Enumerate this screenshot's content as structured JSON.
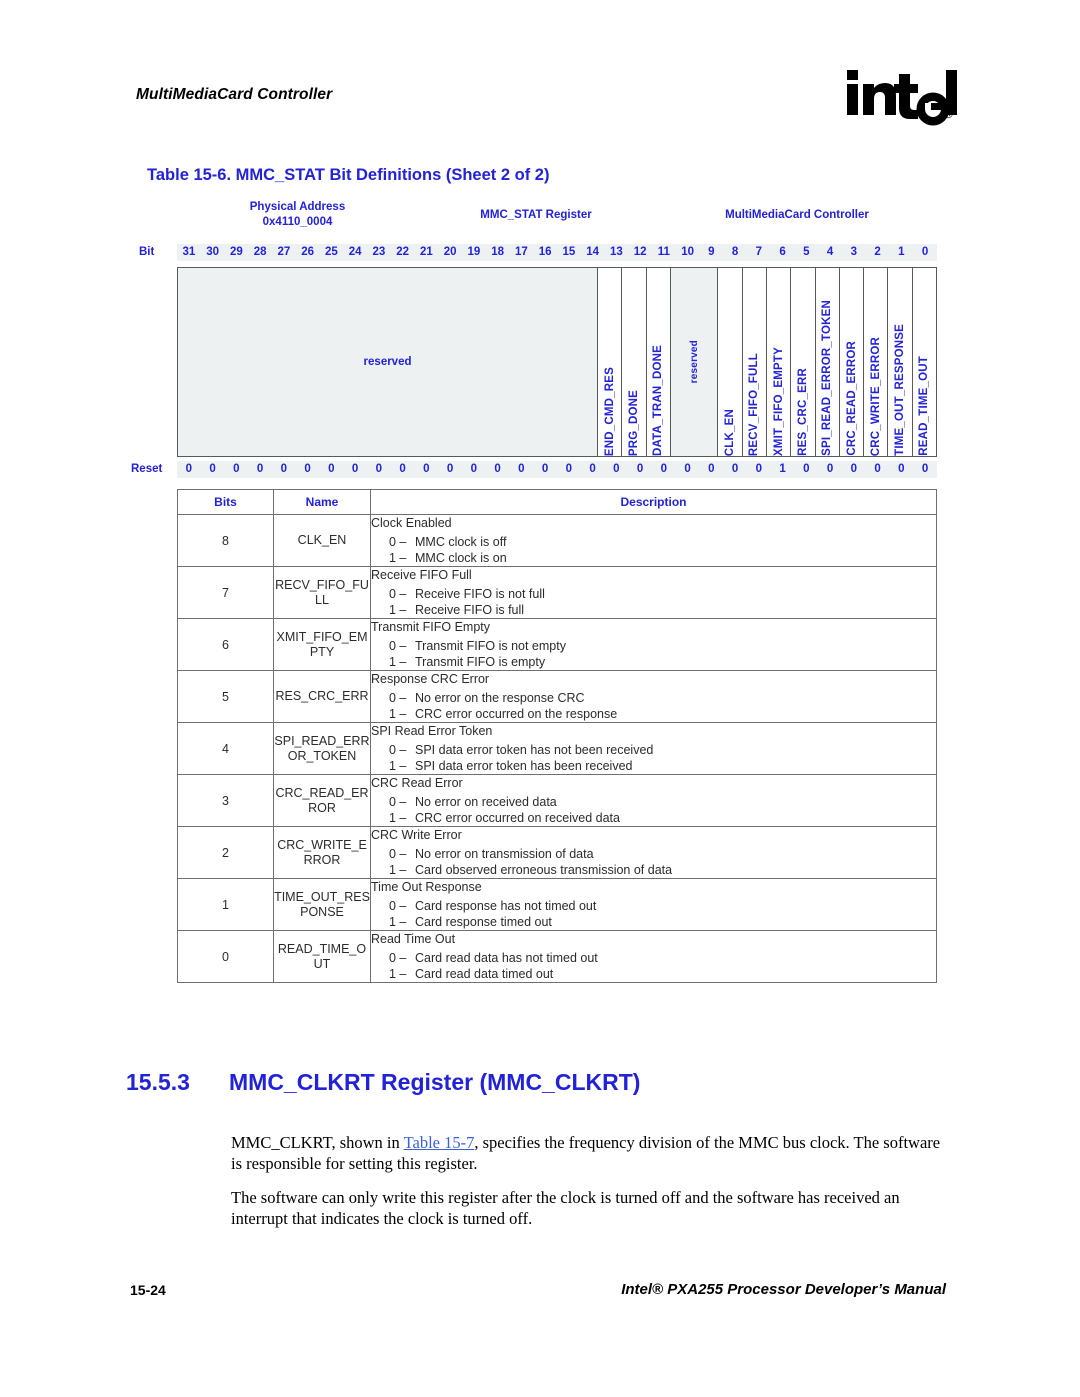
{
  "header": {
    "running_title": "MultiMediaCard Controller",
    "logo_text": "intel",
    "logo_mark": "registered-trademark"
  },
  "table_caption": "Table 15-6. MMC_STAT Bit Definitions (Sheet 2 of 2)",
  "register_diagram": {
    "physical_address_label": "Physical Address",
    "physical_address_value": "0x4110_0004",
    "register_name": "MMC_STAT Register",
    "unit_name": "MultiMediaCard Controller",
    "bit_row_label": "Bit",
    "reset_row_label": "Reset",
    "bit_numbers": [
      "31",
      "30",
      "29",
      "28",
      "27",
      "26",
      "25",
      "24",
      "23",
      "22",
      "21",
      "20",
      "19",
      "18",
      "17",
      "16",
      "15",
      "14",
      "13",
      "12",
      "11",
      "10",
      "9",
      "8",
      "7",
      "6",
      "5",
      "4",
      "3",
      "2",
      "1",
      "0"
    ],
    "reset_values": [
      "0",
      "0",
      "0",
      "0",
      "0",
      "0",
      "0",
      "0",
      "0",
      "0",
      "0",
      "0",
      "0",
      "0",
      "0",
      "0",
      "0",
      "0",
      "0",
      "0",
      "0",
      "0",
      "0",
      "0",
      "0",
      "1",
      "0",
      "0",
      "0",
      "0",
      "0",
      "0"
    ],
    "fields": [
      {
        "label": "reserved",
        "span": 18,
        "style": "grey",
        "orientation": "horizontal"
      },
      {
        "label": "END_CMD_RES",
        "span": 1,
        "style": "white",
        "orientation": "vertical"
      },
      {
        "label": "PRG_DONE",
        "span": 1,
        "style": "white",
        "orientation": "vertical"
      },
      {
        "label": "DATA_TRAN_DONE",
        "span": 1,
        "style": "white",
        "orientation": "vertical"
      },
      {
        "label": "reserved",
        "span": 2,
        "style": "grey",
        "orientation": "vertical"
      },
      {
        "label": "CLK_EN",
        "span": 1,
        "style": "white",
        "orientation": "vertical"
      },
      {
        "label": "RECV_FIFO_FULL",
        "span": 1,
        "style": "white",
        "orientation": "vertical"
      },
      {
        "label": "XMIT_FIFO_EMPTY",
        "span": 1,
        "style": "white",
        "orientation": "vertical"
      },
      {
        "label": "RES_CRC_ERR",
        "span": 1,
        "style": "white",
        "orientation": "vertical"
      },
      {
        "label": "SPI_READ_ERROR_TOKEN",
        "span": 1,
        "style": "white",
        "orientation": "vertical"
      },
      {
        "label": "CRC_READ_ERROR",
        "span": 1,
        "style": "white",
        "orientation": "vertical"
      },
      {
        "label": "CRC_WRITE_ERROR",
        "span": 1,
        "style": "white",
        "orientation": "vertical"
      },
      {
        "label": "TIME_OUT_RESPONSE",
        "span": 1,
        "style": "white",
        "orientation": "vertical"
      },
      {
        "label": "READ_TIME_OUT",
        "span": 1,
        "style": "white",
        "orientation": "vertical"
      }
    ]
  },
  "description_table": {
    "columns": [
      "Bits",
      "Name",
      "Description"
    ],
    "rows": [
      {
        "bits": "8",
        "name": "CLK_EN",
        "title": "Clock Enabled",
        "options": [
          {
            "key": "0 –",
            "text": "MMC clock is off"
          },
          {
            "key": "1 –",
            "text": "MMC clock is on"
          }
        ]
      },
      {
        "bits": "7",
        "name": "RECV_FIFO_FULL",
        "title": "Receive FIFO Full",
        "options": [
          {
            "key": "0 –",
            "text": "Receive FIFO is not full"
          },
          {
            "key": "1 –",
            "text": "Receive FIFO is full"
          }
        ]
      },
      {
        "bits": "6",
        "name": "XMIT_FIFO_EMPTY",
        "title": "Transmit FIFO Empty",
        "options": [
          {
            "key": "0 –",
            "text": "Transmit FIFO is not empty"
          },
          {
            "key": "1 –",
            "text": "Transmit FIFO is empty"
          }
        ]
      },
      {
        "bits": "5",
        "name": "RES_CRC_ERR",
        "title": "Response CRC Error",
        "options": [
          {
            "key": "0 –",
            "text": "No error on the response CRC"
          },
          {
            "key": "1 –",
            "text": "CRC error occurred on the response"
          }
        ]
      },
      {
        "bits": "4",
        "name": "SPI_READ_ERROR_TOKEN",
        "title": "SPI Read Error Token",
        "options": [
          {
            "key": "0 –",
            "text": "SPI data error token has not been received"
          },
          {
            "key": "1 –",
            "text": "SPI data error token has been received"
          }
        ]
      },
      {
        "bits": "3",
        "name": "CRC_READ_ERROR",
        "title": "CRC Read Error",
        "options": [
          {
            "key": "0 –",
            "text": "No error on received data"
          },
          {
            "key": "1 –",
            "text": "CRC error occurred on received data"
          }
        ]
      },
      {
        "bits": "2",
        "name": "CRC_WRITE_ERROR",
        "title": "CRC Write Error",
        "options": [
          {
            "key": "0 –",
            "text": "No error on transmission of data"
          },
          {
            "key": "1 –",
            "text": "Card observed erroneous transmission of data"
          }
        ]
      },
      {
        "bits": "1",
        "name": "TIME_OUT_RESPONSE",
        "title": "Time Out Response",
        "options": [
          {
            "key": "0 –",
            "text": "Card response has not timed out"
          },
          {
            "key": "1 –",
            "text": "Card response timed out"
          }
        ]
      },
      {
        "bits": "0",
        "name": "READ_TIME_OUT",
        "title": "Read Time Out",
        "options": [
          {
            "key": "0 –",
            "text": "Card read data has not timed out"
          },
          {
            "key": "1 –",
            "text": "Card read data timed out"
          }
        ]
      }
    ]
  },
  "section": {
    "number": "15.5.3",
    "title": "MMC_CLKRT Register (MMC_CLKRT)",
    "paragraph_1_before": "MMC_CLKRT, shown in ",
    "paragraph_1_link": "Table 15-7",
    "paragraph_1_after": ", specifies the frequency division of the MMC bus clock. The software is responsible for setting this register.",
    "paragraph_2": "The software can only write this register after the clock is turned off and the software has received an interrupt that indicates the clock is turned off."
  },
  "footer": {
    "page_number": "15-24",
    "manual_title": "Intel® PXA255 Processor Developer’s Manual"
  },
  "colors": {
    "accent_blue": "#2222d8",
    "link_blue": "#3a5fd9",
    "grid_grey": "#eef1f1",
    "border_grey": "#555b5b",
    "text_black": "#000000"
  }
}
